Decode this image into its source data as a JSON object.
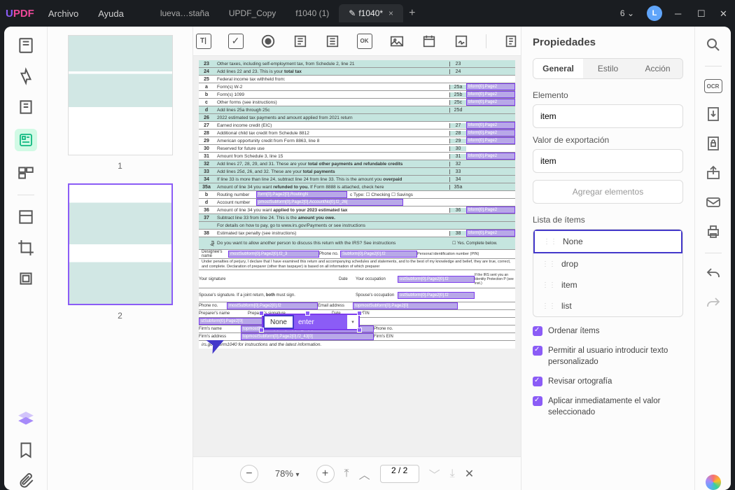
{
  "titlebar": {
    "logo": {
      "u": "U",
      "pdf": "PDF"
    },
    "menu": [
      "Archivo",
      "Ayuda"
    ],
    "tabs": [
      "lueva…staña",
      "UPDF_Copy",
      "f1040 (1)",
      "f1040*"
    ],
    "active_tab": 3,
    "window_num": "6",
    "avatar": "L"
  },
  "thumbs": [
    "1",
    "2"
  ],
  "pdf": {
    "r23": {
      "n": "23",
      "t": "Other taxes, including self-employment tax, from Schedule 2, line 21",
      "rn": "23"
    },
    "r24": {
      "n": "24",
      "t": "Add lines 22 and 23. This is your total tax",
      "rn": "24"
    },
    "r25": {
      "n": "25",
      "t": "Federal income tax withheld from:"
    },
    "r25a": {
      "n": "a",
      "t": "Form(s) W-2",
      "rn": "25a",
      "f": "bform[0].Page2"
    },
    "r25b": {
      "n": "b",
      "t": "Form(s) 1099",
      "rn": "25b",
      "f": "bform[0].Page2"
    },
    "r25c": {
      "n": "c",
      "t": "Other forms (see instructions)",
      "rn": "25c",
      "f": "bform[0].Page2"
    },
    "r25d": {
      "n": "d",
      "t": "Add lines 25a through 25c",
      "rn": "25d"
    },
    "r26": {
      "n": "26",
      "t": "2022 estimated tax payments and amount applied from 2021 return"
    },
    "r27": {
      "n": "27",
      "t": "Earned income credit (EIC)",
      "rn": "27",
      "f": "bform[0].Page2"
    },
    "r28": {
      "n": "28",
      "t": "Additional child tax credit from Schedule 8812",
      "rn": "28",
      "f": "bform[0].Page2"
    },
    "r29": {
      "n": "29",
      "t": "American opportunity credit from Form 8863, line 8",
      "rn": "29",
      "f": "bform[0].Page2"
    },
    "r30": {
      "n": "30",
      "t": "Reserved for future use",
      "rn": "30"
    },
    "r31": {
      "n": "31",
      "t": "Amount from Schedule 3, line 15",
      "rn": "31",
      "f": "bform[0].Page2"
    },
    "r32": {
      "n": "32",
      "t": "Add lines 27, 28, 29, and 31. These are your total other payments and refundable credits",
      "rn": "32"
    },
    "r33": {
      "n": "33",
      "t": "Add lines 25d, 26, and 32. These are your total payments",
      "rn": "33"
    },
    "r34": {
      "n": "34",
      "t": "If line 33 is more than line 24, subtract line 24 from line 33. This is the amount you overpaid",
      "rn": "34"
    },
    "r35a": {
      "n": "35a",
      "t": "Amount of line 34 you want refunded to you. If Form 8888 is attached, check here",
      "rn": "35a"
    },
    "r35b": {
      "n": "b",
      "t": "Routing number",
      "f1": "form[0].Page2[0].RoutingN",
      "t2": "c Type:  ☐ Checking  ☐ Savings"
    },
    "r35d": {
      "n": "d",
      "t": "Account number",
      "f1": "pmostSubform[0].Page2[0].AccountNo[0].f2_26["
    },
    "r36": {
      "n": "36",
      "t": "Amount of line 34 you want applied to your 2023 estimated tax",
      "rn": "36",
      "f": "bform[0].Page2"
    },
    "r37": {
      "n": "37",
      "t": "Subtract line 33 from line 24. This is the amount you owe."
    },
    "r37b": {
      "t": "For details on how to pay, go to www.irs.gov/Payments or see instructions"
    },
    "r38": {
      "n": "38",
      "t": "Estimated tax penalty (see instructions)",
      "rn": "38",
      "f": "bform[0].Page2"
    },
    "third": {
      "t": "Do you want to allow another person to discuss this return with the IRS? See instructions",
      "yes": "☐ Yes. Complete below."
    },
    "designee": {
      "t": "Designee's name",
      "f": "mostSubform[0].Page2[0].f2_3",
      "ph": "Phone no.",
      "f2": "Subform[0].Page2[0].f2",
      "pin": "Personal identification number (PIN)"
    },
    "penalties": "Under penalties of perjury, I declare that I have examined this return and accompanying schedules and statements, and to the best of my knowledge and belief, they are true, correct, and complete. Declaration of preparer (other than taxpayer) is based on all information of which preparer",
    "sig": {
      "your": "Your signature",
      "date": "Date",
      "occ": "Your occupation",
      "f": "ostSubform[0].Page2[0].f2",
      "irs": "If the IRS sent you an Identity Protection P  (see inst.)"
    },
    "spouse": {
      "t": "Spouse's signature. If a joint return, both must sign.",
      "occ": "Spouse's occupation",
      "f": "ostSubform[0].Page2[0].f2"
    },
    "phone": {
      "t": "Phone no.",
      "f": "mostSubform[0].Page2[0].f2",
      "em": "Email address",
      "f2": "topmostSubform[0].Page2[0]"
    },
    "prep": {
      "name": "Preparer's name",
      "sig": "Preparer's signature",
      "date": "Date",
      "ptin": "PTIN",
      "f": "stSubform[0].Page2[0]"
    },
    "firm": {
      "name": "Firm's name",
      "f1": "topmostSubform[0].Page2[0].f2_41[0]",
      "addr": "Firm's address",
      "f2": "topmostSubform[0].Page2[0].f2_43[0]",
      "phone": "Phone no.",
      "ein": "Firm's EIN"
    },
    "footer": "irs.gov/Form1040 for instructions and the latest information."
  },
  "dropdown": {
    "selected": "None",
    "hint": "enter"
  },
  "bottom": {
    "zoom": "78%",
    "page": "2  /  2"
  },
  "props": {
    "title": "Propiedades",
    "tabs": [
      "General",
      "Estilo",
      "Acción"
    ],
    "element_label": "Elemento",
    "element_value": "item",
    "export_label": "Valor de exportación",
    "export_value": "item",
    "add_btn": "Agregar elementos",
    "list_label": "Lista de ítems",
    "items": [
      "None",
      "drop",
      "item",
      "list"
    ],
    "checks": [
      "Ordenar ítems",
      "Permitir al usuario introducir texto personalizado",
      "Revisar ortografía",
      "Aplicar inmediatamente el valor seleccionado"
    ]
  }
}
